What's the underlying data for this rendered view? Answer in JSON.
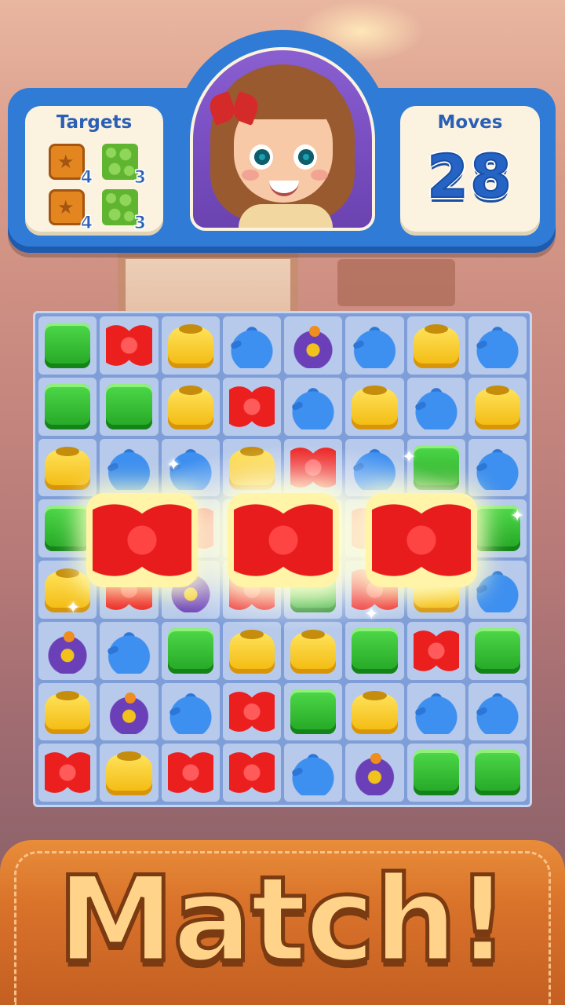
{
  "header": {
    "targets_title": "Targets",
    "moves_title": "Moves",
    "moves_value": "28",
    "targets": [
      {
        "icon": "crate-icon",
        "count": "4"
      },
      {
        "icon": "grass-icon",
        "count": "3"
      },
      {
        "icon": "crate-icon",
        "count": "4"
      },
      {
        "icon": "grass-icon",
        "count": "3"
      }
    ]
  },
  "board": {
    "rows": [
      [
        "green",
        "red",
        "yellow",
        "blue",
        "purple",
        "blue",
        "yellow",
        "blue"
      ],
      [
        "green",
        "green",
        "yellow",
        "red",
        "blue",
        "yellow",
        "blue",
        "yellow"
      ],
      [
        "yellow",
        "blue",
        "blue",
        "yellow",
        "red",
        "blue",
        "green",
        "blue"
      ],
      [
        "green",
        "red",
        "red",
        "red",
        "red",
        "red",
        "red",
        "green"
      ],
      [
        "yellow",
        "red",
        "purple",
        "red",
        "green",
        "red",
        "yellow",
        "blue"
      ],
      [
        "purple",
        "blue",
        "green",
        "yellow",
        "yellow",
        "green",
        "red",
        "green"
      ],
      [
        "yellow",
        "purple",
        "blue",
        "red",
        "green",
        "yellow",
        "blue",
        "blue"
      ],
      [
        "red",
        "yellow",
        "red",
        "red",
        "blue",
        "purple",
        "green",
        "green"
      ]
    ]
  },
  "banner": {
    "text": "Match!"
  }
}
